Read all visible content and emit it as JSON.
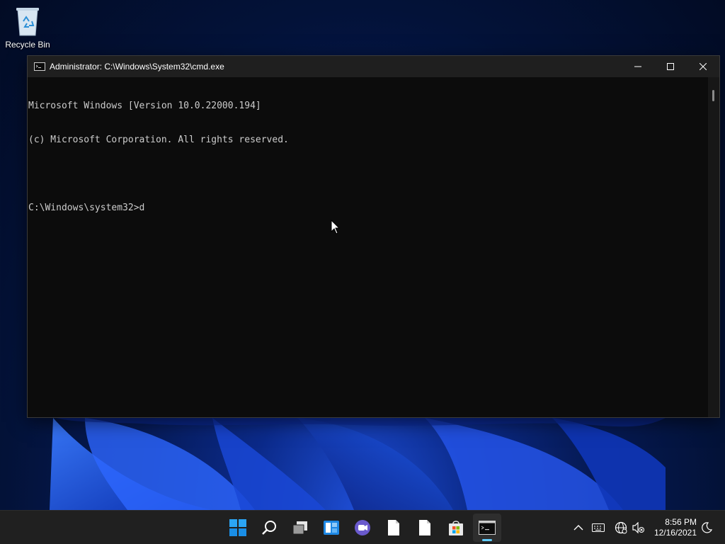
{
  "desktop": {
    "icons": [
      {
        "label": "Recycle Bin",
        "icon": "recycle-bin-icon"
      }
    ]
  },
  "window": {
    "title": "Administrator: C:\\Windows\\System32\\cmd.exe",
    "icon": "cmd-icon",
    "controls": [
      "minimize-icon",
      "maximize-icon",
      "close-icon"
    ]
  },
  "console": {
    "lines": [
      "Microsoft Windows [Version 10.0.22000.194]",
      "(c) Microsoft Corporation. All rights reserved.",
      "",
      "C:\\Windows\\system32>d"
    ]
  },
  "taskbar": {
    "apps": [
      {
        "name": "start",
        "icon": "windows-logo-icon",
        "active": false
      },
      {
        "name": "search",
        "icon": "search-icon",
        "active": false
      },
      {
        "name": "task-view",
        "icon": "task-view-icon",
        "active": false
      },
      {
        "name": "widgets",
        "icon": "widgets-icon",
        "active": false
      },
      {
        "name": "chat",
        "icon": "teams-chat-icon",
        "active": false
      },
      {
        "name": "file-1",
        "icon": "document-icon",
        "active": false
      },
      {
        "name": "file-2",
        "icon": "document-icon",
        "active": false
      },
      {
        "name": "store",
        "icon": "microsoft-store-icon",
        "active": false
      },
      {
        "name": "cmd",
        "icon": "terminal-icon",
        "active": true
      }
    ],
    "tray": {
      "icons": [
        "chevron-up-icon",
        "keyboard-icon",
        "network-globe-icon",
        "volume-muted-icon",
        "night-mode-icon"
      ],
      "time": "8:56 PM",
      "date": "12/16/2021"
    }
  },
  "colors": {
    "console_bg": "#0c0c0c",
    "console_text": "#cccccc",
    "titlebar_bg": "#1f1f1f",
    "taskbar_bg": "#202020",
    "accent": "#60cdff"
  }
}
